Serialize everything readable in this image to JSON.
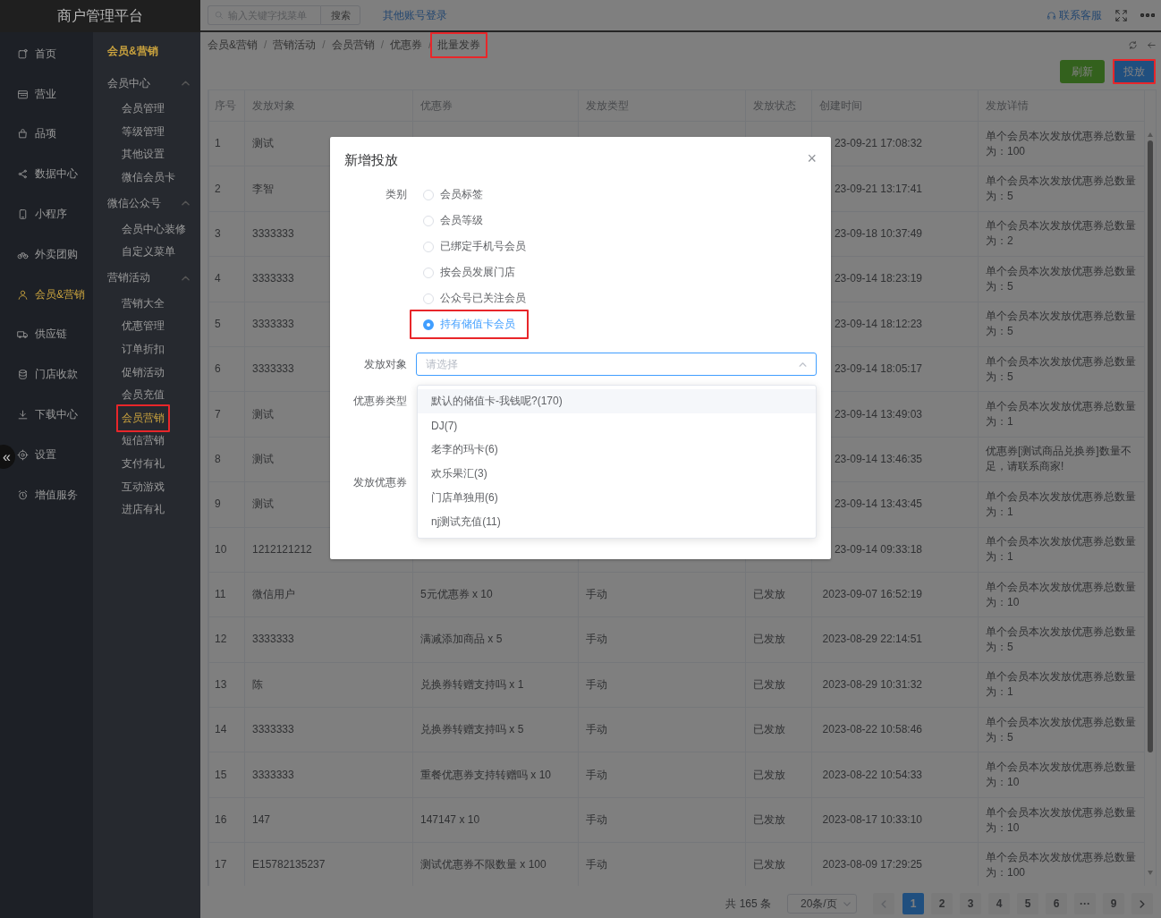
{
  "app": {
    "title": "商户管理平台",
    "collapse_button": "«"
  },
  "nav": [
    {
      "label": "首页",
      "selected": false
    },
    {
      "label": "营业",
      "selected": false
    },
    {
      "label": "品项",
      "selected": false
    },
    {
      "label": "数据中心",
      "selected": false
    },
    {
      "label": "小程序",
      "selected": false
    },
    {
      "label": "外卖团购",
      "selected": false
    },
    {
      "label": "会员&营销",
      "selected": true
    },
    {
      "label": "供应链",
      "selected": false
    },
    {
      "label": "门店收款",
      "selected": false
    },
    {
      "label": "下载中心",
      "selected": false
    },
    {
      "label": "设置",
      "selected": false
    },
    {
      "label": "增值服务",
      "selected": false
    }
  ],
  "subnav": {
    "title": "会员&营销",
    "groups": [
      {
        "label": "会员中心",
        "expanded": true,
        "children": [
          {
            "label": "会员管理",
            "selected": false,
            "highlighted": false
          },
          {
            "label": "等级管理",
            "selected": false,
            "highlighted": false
          },
          {
            "label": "其他设置",
            "selected": false,
            "highlighted": false
          },
          {
            "label": "微信会员卡",
            "selected": false,
            "highlighted": false
          }
        ]
      },
      {
        "label": "微信公众号",
        "expanded": true,
        "children": [
          {
            "label": "会员中心装修",
            "selected": false,
            "highlighted": false
          },
          {
            "label": "自定义菜单",
            "selected": false,
            "highlighted": false
          }
        ]
      },
      {
        "label": "营销活动",
        "expanded": true,
        "children": [
          {
            "label": "营销大全",
            "selected": false,
            "highlighted": false
          },
          {
            "label": "优惠管理",
            "selected": false,
            "highlighted": false
          },
          {
            "label": "订单折扣",
            "selected": false,
            "highlighted": false
          },
          {
            "label": "促销活动",
            "selected": false,
            "highlighted": false
          },
          {
            "label": "会员充值",
            "selected": false,
            "highlighted": false
          },
          {
            "label": "会员营销",
            "selected": true,
            "highlighted": true
          },
          {
            "label": "短信营销",
            "selected": false,
            "highlighted": false
          },
          {
            "label": "支付有礼",
            "selected": false,
            "highlighted": false
          },
          {
            "label": "互动游戏",
            "selected": false,
            "highlighted": false
          },
          {
            "label": "进店有礼",
            "selected": false,
            "highlighted": false
          }
        ]
      }
    ]
  },
  "topbar": {
    "search": {
      "placeholder": "输入关键字找菜单"
    },
    "search_button": "搜索",
    "link": "其他账号登录",
    "support": "联系客服"
  },
  "breadcrumb": {
    "items": [
      {
        "label": "会员&营销",
        "highlighted": false
      },
      {
        "label": "营销活动",
        "highlighted": false
      },
      {
        "label": "会员营销",
        "highlighted": false
      },
      {
        "label": "优惠券",
        "highlighted": false
      },
      {
        "label": "批量发券",
        "highlighted": true
      }
    ],
    "separators": [
      "/",
      "/",
      "/",
      "/"
    ]
  },
  "toolbar": {
    "buttons": [
      {
        "label": "刷新",
        "kind": "success",
        "highlighted": false
      },
      {
        "label": "投放",
        "kind": "primary",
        "highlighted": true
      }
    ]
  },
  "table": {
    "columns": [
      "序号",
      "发放对象",
      "优惠券",
      "发放类型",
      "发放状态",
      "创建时间",
      "发放详情"
    ],
    "rows": [
      {
        "index": "1",
        "target": "测试",
        "created": "23-09-21 17:08:32",
        "details": "单个会员本次发放优惠券总数量为：100"
      },
      {
        "index": "2",
        "target": "李智",
        "created": "23-09-21 13:17:41",
        "details": "单个会员本次发放优惠券总数量为：5"
      },
      {
        "index": "3",
        "target": "3333333",
        "created": "23-09-18 10:37:49",
        "details": "单个会员本次发放优惠券总数量为：2"
      },
      {
        "index": "4",
        "target": "3333333",
        "created": "23-09-14 18:23:19",
        "details": "单个会员本次发放优惠券总数量为：5"
      },
      {
        "index": "5",
        "target": "3333333",
        "created": "23-09-14 18:12:23",
        "details": "单个会员本次发放优惠券总数量为：5"
      },
      {
        "index": "6",
        "target": "3333333",
        "created": "23-09-14 18:05:17",
        "details": "单个会员本次发放优惠券总数量为：5"
      },
      {
        "index": "7",
        "target": "测试",
        "created": "23-09-14 13:49:03",
        "details": "单个会员本次发放优惠券总数量为：1"
      },
      {
        "index": "8",
        "target": "测试",
        "created": "23-09-14 13:46:35",
        "details": "优惠券[测试商品兑换券]数量不足，请联系商家!"
      },
      {
        "index": "9",
        "target": "测试",
        "created": "23-09-14 13:43:45",
        "details": "单个会员本次发放优惠券总数量为：1"
      },
      {
        "index": "10",
        "target": "1212121212",
        "created": "23-09-14 09:33:18",
        "details": "单个会员本次发放优惠券总数量为：1"
      },
      {
        "index": "11",
        "target": "微信用户",
        "coupon": "5元优惠券 x 10",
        "type": "手动",
        "status": "已发放",
        "created": "2023-09-07 16:52:19",
        "details": "单个会员本次发放优惠券总数量为：10"
      },
      {
        "index": "12",
        "target": "3333333",
        "coupon": "满减添加商品 x 5",
        "type": "手动",
        "status": "已发放",
        "created": "2023-08-29 22:14:51",
        "details": "单个会员本次发放优惠券总数量为：5"
      },
      {
        "index": "13",
        "target": "陈",
        "coupon": "兑换券转赠支持吗 x 1",
        "type": "手动",
        "status": "已发放",
        "created": "2023-08-29 10:31:32",
        "details": "单个会员本次发放优惠券总数量为：1"
      },
      {
        "index": "14",
        "target": "3333333",
        "coupon": "兑换券转赠支持吗 x 5",
        "type": "手动",
        "status": "已发放",
        "created": "2023-08-22 10:58:46",
        "details": "单个会员本次发放优惠券总数量为：5"
      },
      {
        "index": "15",
        "target": "3333333",
        "coupon": "重餐优惠券支持转赠吗 x 10",
        "type": "手动",
        "status": "已发放",
        "created": "2023-08-22 10:54:33",
        "details": "单个会员本次发放优惠券总数量为：10"
      },
      {
        "index": "16",
        "target": "147",
        "coupon": "147147 x 10",
        "type": "手动",
        "status": "已发放",
        "created": "2023-08-17 10:33:10",
        "details": "单个会员本次发放优惠券总数量为：10"
      },
      {
        "index": "17",
        "target": "E15782135237",
        "coupon": "测试优惠券不限数量 x 100",
        "type": "手动",
        "status": "已发放",
        "created": "2023-08-09 17:29:25",
        "details": "单个会员本次发放优惠券总数量为：100"
      }
    ]
  },
  "pagination": {
    "total": "共 165 条",
    "page_size": "20条/页",
    "prev": {
      "disabled": true
    },
    "next": {
      "disabled": false
    },
    "pages": [
      {
        "label": "1",
        "selected": true
      },
      {
        "label": "2",
        "selected": false
      },
      {
        "label": "3",
        "selected": false
      },
      {
        "label": "4",
        "selected": false
      },
      {
        "label": "5",
        "selected": false
      },
      {
        "label": "6",
        "selected": false
      },
      {
        "label": "···",
        "selected": false
      },
      {
        "label": "9",
        "selected": false
      }
    ]
  },
  "modal": {
    "title": "新增投放",
    "close": "×",
    "fields": [
      {
        "label": "类别",
        "kind": "radio",
        "options": [
          {
            "label": "会员标签",
            "selected": false,
            "highlighted": false
          },
          {
            "label": "会员等级",
            "selected": false,
            "highlighted": false
          },
          {
            "label": "已绑定手机号会员",
            "selected": false,
            "highlighted": false
          },
          {
            "label": "按会员发展门店",
            "selected": false,
            "highlighted": false
          },
          {
            "label": "公众号已关注会员",
            "selected": false,
            "highlighted": false
          },
          {
            "label": "持有储值卡会员",
            "selected": true,
            "highlighted": true
          }
        ]
      },
      {
        "label": "发放对象",
        "kind": "select",
        "placeholder": "请选择",
        "expanded": true,
        "options": [
          {
            "label": "默认的储值卡-我钱呢?(170)",
            "hovered": true
          },
          {
            "label": "DJ(7)",
            "hovered": false
          },
          {
            "label": "老李的玛卡(6)",
            "hovered": false
          },
          {
            "label": "欢乐果汇(3)",
            "hovered": false
          },
          {
            "label": "门店单独用(6)",
            "hovered": false
          },
          {
            "label": "nj测试充值(11)",
            "hovered": false
          }
        ]
      },
      {
        "label": "优惠券类型",
        "kind": "covered"
      },
      {
        "label": "发放优惠券",
        "kind": "covered"
      }
    ]
  }
}
